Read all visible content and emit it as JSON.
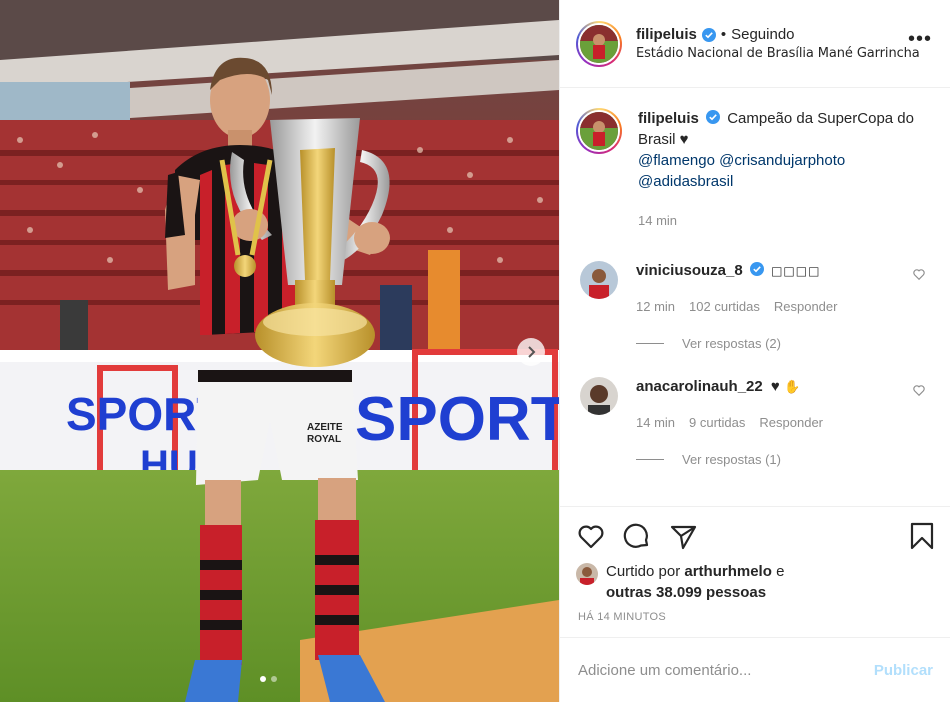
{
  "header": {
    "username": "filipeluis",
    "separator": "•",
    "follow_status": "Seguindo",
    "location": "Estádio Nacional de Brasília Mané Garrincha",
    "more_icon": "more-dots-icon"
  },
  "caption": {
    "username": "filipeluis",
    "text": "Campeão da SuperCopa do Brasil ♥",
    "tags": [
      "@flamengo",
      "@crisandujarphoto",
      "@adidasbrasil"
    ],
    "time": "14 min"
  },
  "comments": [
    {
      "username": "viniciusouza_8",
      "verified": true,
      "text": "",
      "time": "12 min",
      "likes": "102 curtidas",
      "reply_label": "Responder",
      "replies_label": "Ver respostas (2)"
    },
    {
      "username": "anacarolinauh_22",
      "verified": false,
      "text": "♥",
      "time": "14 min",
      "likes": "9 curtidas",
      "reply_label": "Responder",
      "replies_label": "Ver respostas (1)"
    }
  ],
  "liked_by": {
    "prefix": "Curtido por",
    "user": "arthurhmelo",
    "connector": "e",
    "others": "outras 38.099 pessoas"
  },
  "post_time": "HÁ 14 MINUTOS",
  "add_comment": {
    "placeholder": "Adicione um comentário...",
    "publish_label": "Publicar"
  },
  "photo": {
    "banner_text": "SPORT",
    "banner_text_2": "HU",
    "banner_text_left": "SPORT",
    "shorts_text": "AZEITE ROYAL",
    "carousel_active_index": 0,
    "carousel_count": 2
  },
  "colors": {
    "verified_blue": "#3897f0",
    "link_blue": "#00376b",
    "muted_gray": "#8e8e8e",
    "publish_disabled": "#b2dffc"
  }
}
